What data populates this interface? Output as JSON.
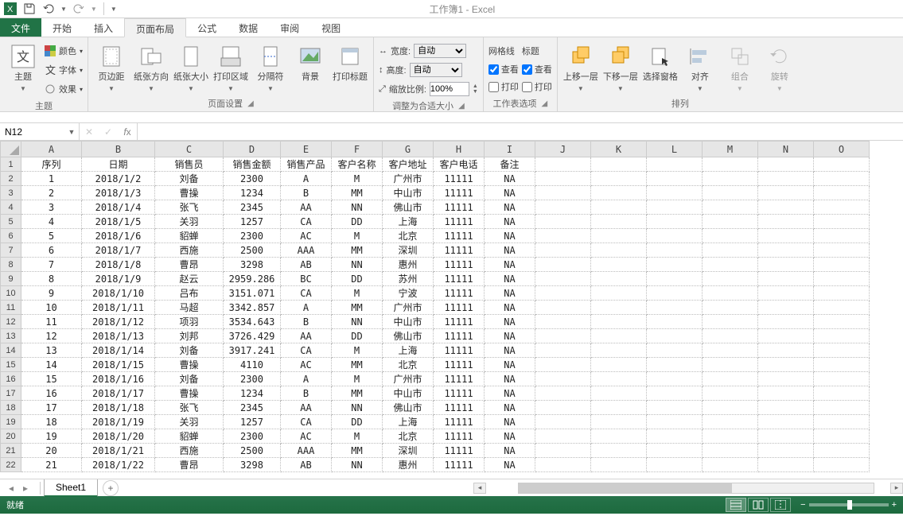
{
  "app": {
    "title": "工作簿1 - Excel"
  },
  "tabs": {
    "file": "文件",
    "items": [
      "开始",
      "插入",
      "页面布局",
      "公式",
      "数据",
      "审阅",
      "视图"
    ],
    "active": 2
  },
  "ribbon": {
    "themes": {
      "theme": "主题",
      "colors": "颜色",
      "fonts": "字体",
      "effects": "效果",
      "label": "主题"
    },
    "pagesetup": {
      "margins": "页边距",
      "orientation": "纸张方向",
      "size": "纸张大小",
      "printarea": "打印区域",
      "breaks": "分隔符",
      "background": "背景",
      "printtitles": "打印标题",
      "label": "页面设置"
    },
    "scale": {
      "width_lbl": "宽度:",
      "width_val": "自动",
      "height_lbl": "高度:",
      "height_val": "自动",
      "scale_lbl": "缩放比例:",
      "scale_val": "100%",
      "label": "调整为合适大小"
    },
    "sheetopts": {
      "gridlines": "网格线",
      "view1": "查看",
      "print1": "打印",
      "headings": "标题",
      "view2": "查看",
      "print2": "打印",
      "label": "工作表选项"
    },
    "arrange": {
      "forward": "上移一层",
      "backward": "下移一层",
      "selection": "选择窗格",
      "align": "对齐",
      "group": "组合",
      "rotate": "旋转",
      "label": "排列"
    }
  },
  "namebox": "N12",
  "columns": {
    "headers": [
      "A",
      "B",
      "C",
      "D",
      "E",
      "F",
      "G",
      "H",
      "I",
      "J",
      "K",
      "L",
      "M",
      "N",
      "O"
    ],
    "widths": [
      76,
      92,
      86,
      72,
      64,
      64,
      64,
      64,
      64,
      70,
      70,
      70,
      70,
      70,
      70
    ]
  },
  "chart_data": {
    "type": "table",
    "header": [
      "序列",
      "日期",
      "销售员",
      "销售金额",
      "销售产品",
      "客户名称",
      "客户地址",
      "客户电话",
      "备注"
    ],
    "rows": [
      [
        "1",
        "2018/1/2",
        "刘备",
        "2300",
        "A",
        "M",
        "广州市",
        "11111",
        "NA"
      ],
      [
        "2",
        "2018/1/3",
        "曹操",
        "1234",
        "B",
        "MM",
        "中山市",
        "11111",
        "NA"
      ],
      [
        "3",
        "2018/1/4",
        "张飞",
        "2345",
        "AA",
        "NN",
        "佛山市",
        "11111",
        "NA"
      ],
      [
        "4",
        "2018/1/5",
        "关羽",
        "1257",
        "CA",
        "DD",
        "上海",
        "11111",
        "NA"
      ],
      [
        "5",
        "2018/1/6",
        "貂蝉",
        "2300",
        "AC",
        "M",
        "北京",
        "11111",
        "NA"
      ],
      [
        "6",
        "2018/1/7",
        "西施",
        "2500",
        "AAA",
        "MM",
        "深圳",
        "11111",
        "NA"
      ],
      [
        "7",
        "2018/1/8",
        "曹昂",
        "3298",
        "AB",
        "NN",
        "惠州",
        "11111",
        "NA"
      ],
      [
        "8",
        "2018/1/9",
        "赵云",
        "2959.286",
        "BC",
        "DD",
        "苏州",
        "11111",
        "NA"
      ],
      [
        "9",
        "2018/1/10",
        "吕布",
        "3151.071",
        "CA",
        "M",
        "宁波",
        "11111",
        "NA"
      ],
      [
        "10",
        "2018/1/11",
        "马超",
        "3342.857",
        "A",
        "MM",
        "广州市",
        "11111",
        "NA"
      ],
      [
        "11",
        "2018/1/12",
        "项羽",
        "3534.643",
        "B",
        "NN",
        "中山市",
        "11111",
        "NA"
      ],
      [
        "12",
        "2018/1/13",
        "刘邦",
        "3726.429",
        "AA",
        "DD",
        "佛山市",
        "11111",
        "NA"
      ],
      [
        "13",
        "2018/1/14",
        "刘备",
        "3917.241",
        "CA",
        "M",
        "上海",
        "11111",
        "NA"
      ],
      [
        "14",
        "2018/1/15",
        "曹操",
        "4110",
        "AC",
        "MM",
        "北京",
        "11111",
        "NA"
      ],
      [
        "15",
        "2018/1/16",
        "刘备",
        "2300",
        "A",
        "M",
        "广州市",
        "11111",
        "NA"
      ],
      [
        "16",
        "2018/1/17",
        "曹操",
        "1234",
        "B",
        "MM",
        "中山市",
        "11111",
        "NA"
      ],
      [
        "17",
        "2018/1/18",
        "张飞",
        "2345",
        "AA",
        "NN",
        "佛山市",
        "11111",
        "NA"
      ],
      [
        "18",
        "2018/1/19",
        "关羽",
        "1257",
        "CA",
        "DD",
        "上海",
        "11111",
        "NA"
      ],
      [
        "19",
        "2018/1/20",
        "貂蝉",
        "2300",
        "AC",
        "M",
        "北京",
        "11111",
        "NA"
      ],
      [
        "20",
        "2018/1/21",
        "西施",
        "2500",
        "AAA",
        "MM",
        "深圳",
        "11111",
        "NA"
      ],
      [
        "21",
        "2018/1/22",
        "曹昂",
        "3298",
        "AB",
        "NN",
        "惠州",
        "11111",
        "NA"
      ]
    ]
  },
  "sheet_tab": "Sheet1",
  "status": {
    "ready": "就绪",
    "zoom": "100%"
  }
}
